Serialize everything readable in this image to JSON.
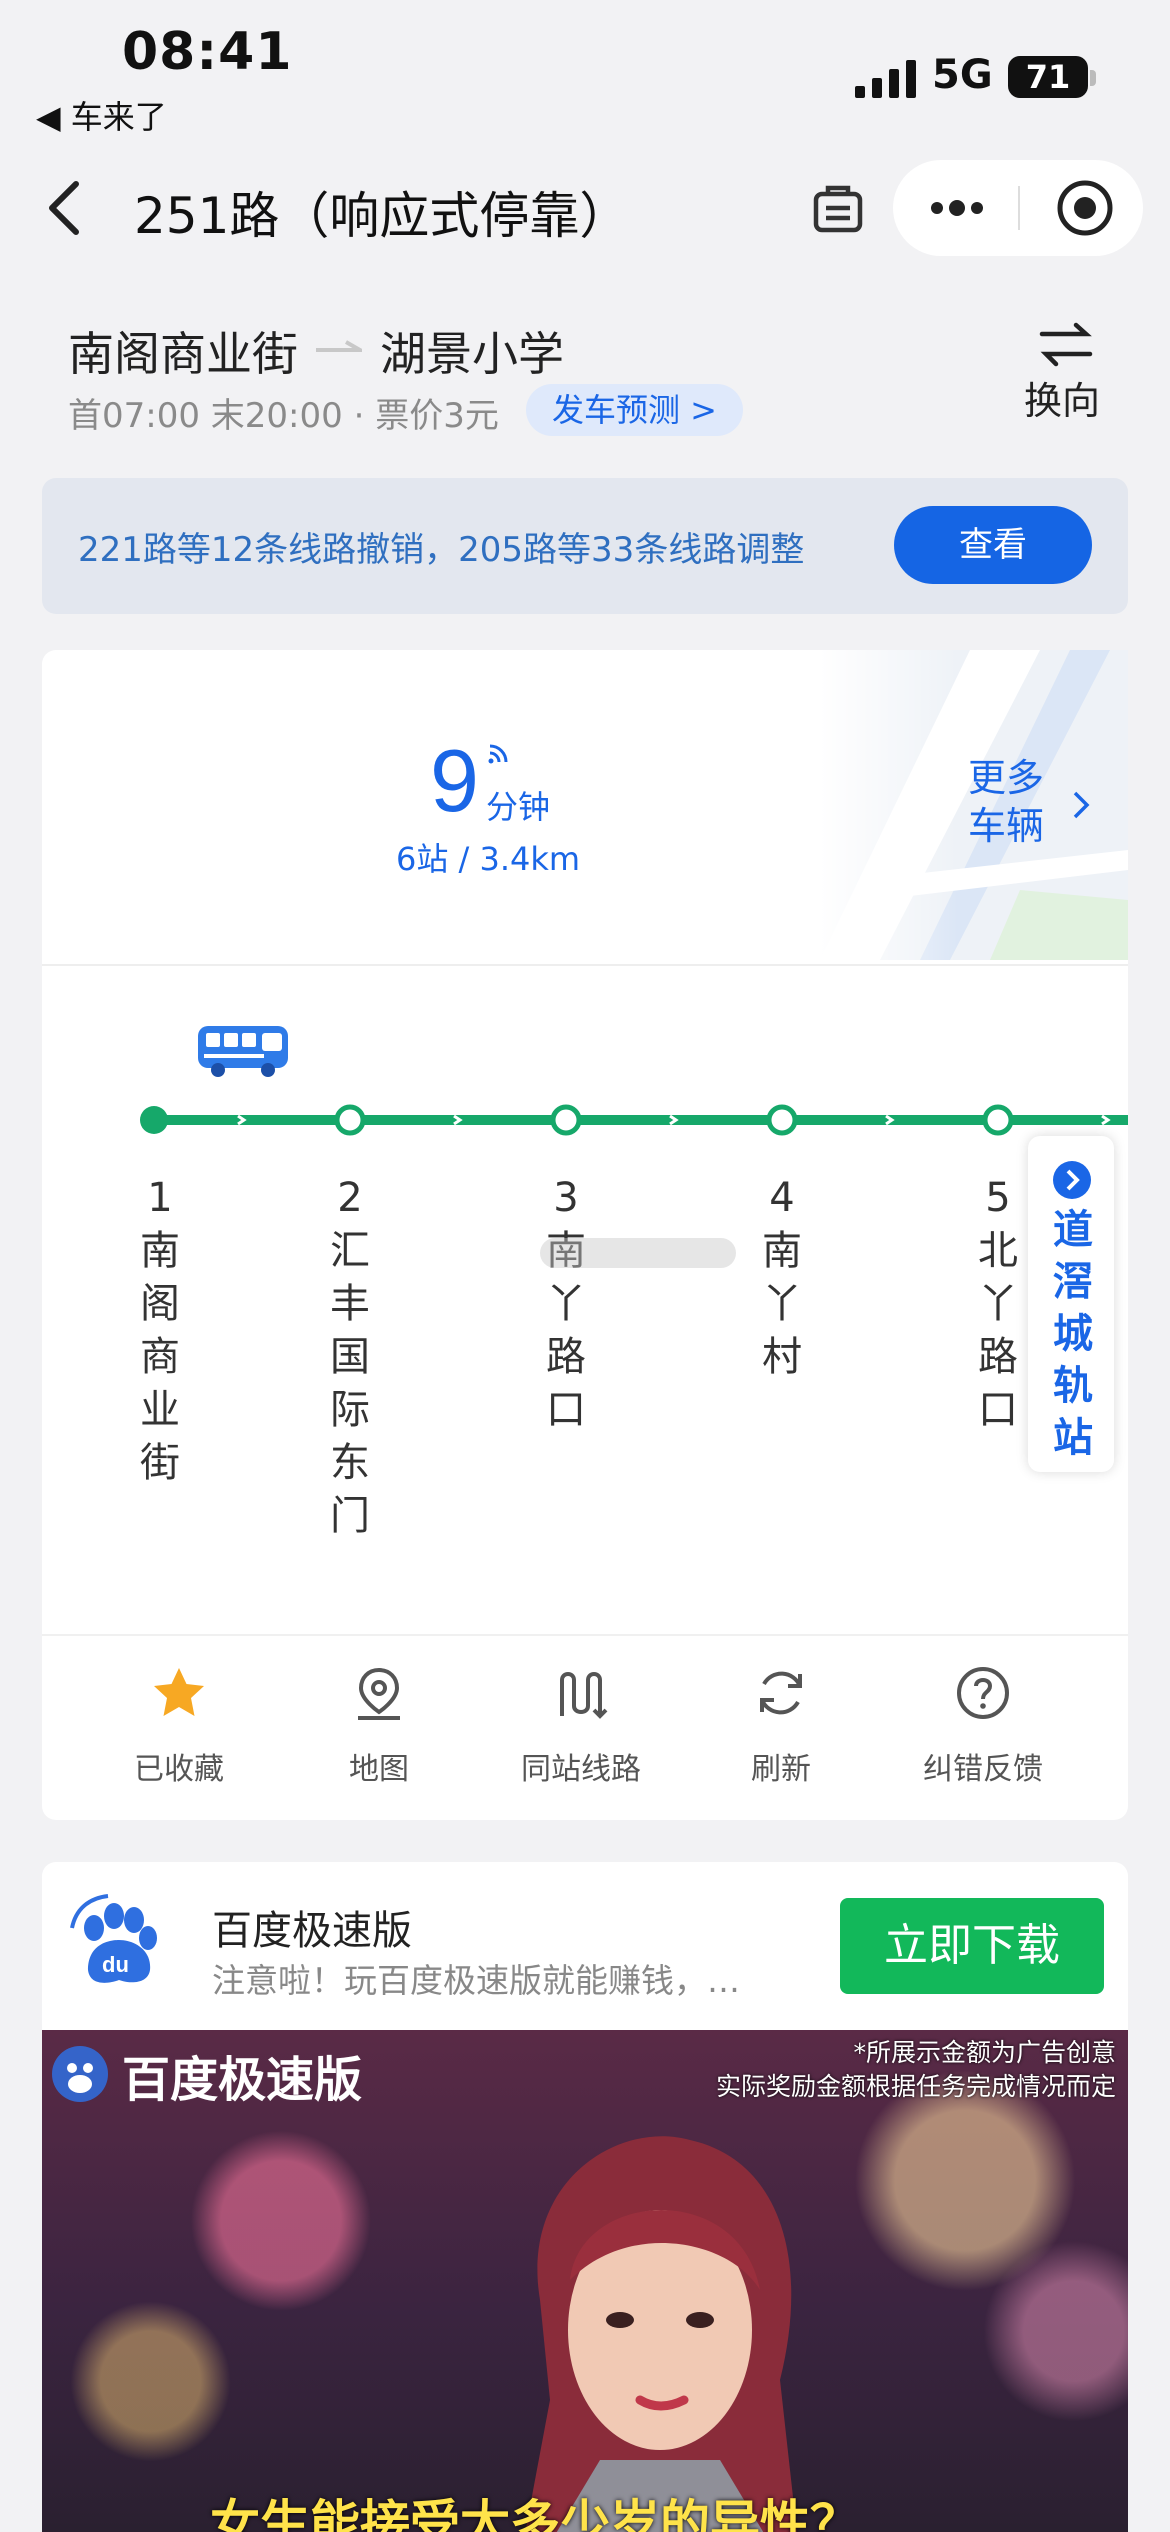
{
  "status_bar": {
    "time": "08:41",
    "back_app": "◀ 车来了",
    "network": "5G",
    "battery": "71"
  },
  "nav": {
    "title": "251路（响应式停靠）"
  },
  "route": {
    "from": "南阁商业街",
    "to": "湖景小学",
    "info": "首07:00 末20:00 · 票价3元",
    "forecast_label": "发车预测 >",
    "switch_label": "换向"
  },
  "notice": {
    "text": "221路等12条线路撤销，205路等33条线路调整",
    "button": "查看"
  },
  "eta": {
    "minutes": "9",
    "unit": "分钟",
    "sub": "6站 / 3.4km",
    "more_line1": "更多",
    "more_line2": "车辆"
  },
  "stops": [
    {
      "num": "1",
      "name": "南阁商业街"
    },
    {
      "num": "2",
      "name": "汇丰国际东门"
    },
    {
      "num": "3",
      "name": "南丫路口"
    },
    {
      "num": "4",
      "name": "南丫村"
    },
    {
      "num": "5",
      "name": "北丫路口"
    }
  ],
  "end_stop": {
    "name": "道滘城轨站"
  },
  "tools": [
    {
      "label": "已收藏",
      "icon": "star-icon"
    },
    {
      "label": "地图",
      "icon": "map-pin-icon"
    },
    {
      "label": "同站线路",
      "icon": "route-icon"
    },
    {
      "label": "刷新",
      "icon": "refresh-icon"
    },
    {
      "label": "纠错反馈",
      "icon": "help-icon"
    }
  ],
  "ad": {
    "title": "百度极速版",
    "desc": "注意啦！玩百度极速版就能赚钱，…",
    "button": "立即下载",
    "brand": "百度极速版",
    "note_line1": "*所展示金额为广告创意",
    "note_line2": "实际奖励金额根据任务完成情况而定",
    "subtitle": "女生能接受太多少岁的异性？"
  },
  "colors": {
    "accent": "#1a66e6",
    "line_green": "#16a86a",
    "download_green": "#12b85a"
  }
}
